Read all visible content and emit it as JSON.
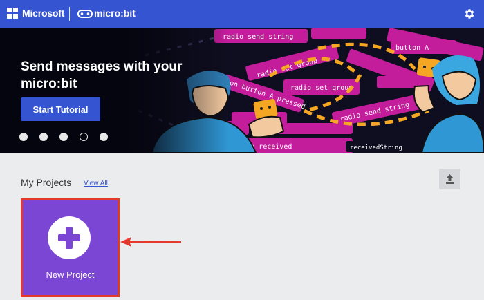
{
  "header": {
    "brand": "Microsoft",
    "product": "micro:bit",
    "colors": {
      "bar": "#3454d1"
    },
    "icons": [
      "microsoft-logo-icon",
      "microbit-logo-icon",
      "gear-icon"
    ]
  },
  "hero": {
    "title": "Send messages with your micro:bit",
    "button_label": "Start Tutorial",
    "carousel": {
      "dot_count": 5,
      "active_index": 3
    },
    "art_blocks": [
      "radio send string",
      "radio set group",
      "on button A pressed",
      "radio set group",
      "radio send string",
      "on radio received",
      "receivedString",
      "button A"
    ]
  },
  "projects": {
    "title": "My Projects",
    "view_all": "View All",
    "new_project_label": "New Project",
    "colors": {
      "card": "#7b46d3",
      "highlight": "#e5392b"
    },
    "icons": [
      "upload-icon",
      "plus-icon"
    ]
  }
}
